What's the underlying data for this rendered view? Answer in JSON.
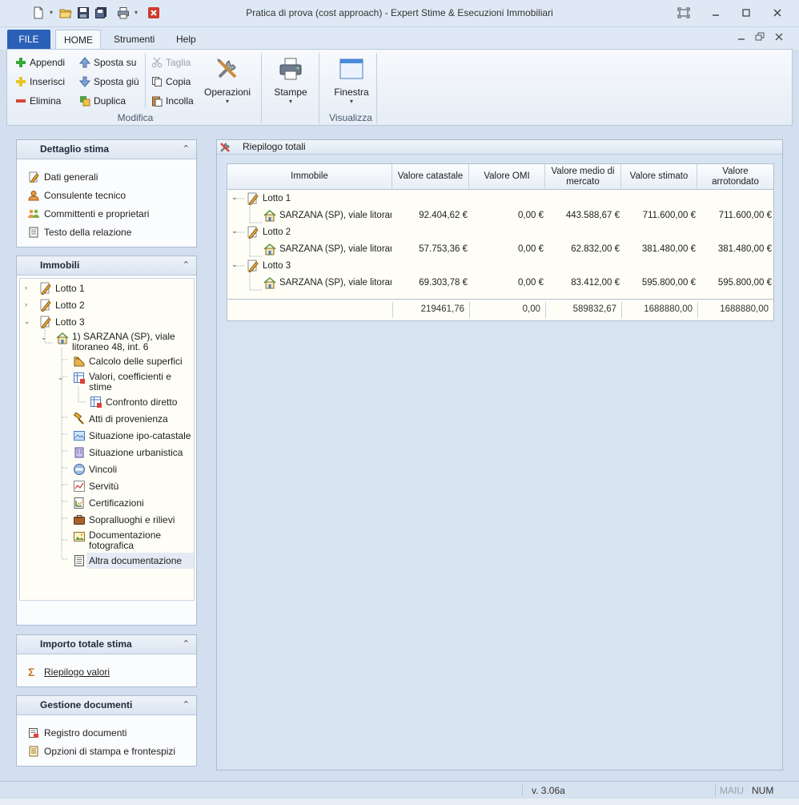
{
  "window": {
    "title": "Pratica di prova (cost approach) - Expert Stime & Esecuzioni Immobiliari"
  },
  "tabs": [
    {
      "label": "FILE"
    },
    {
      "label": "HOME"
    },
    {
      "label": "Strumenti"
    },
    {
      "label": "Help"
    }
  ],
  "ribbon": {
    "modifica": {
      "appendi": "Appendi",
      "inserisci": "Inserisci",
      "elimina": "Elimina",
      "sposta_su": "Sposta su",
      "sposta_giu": "Sposta giù",
      "duplica": "Duplica",
      "taglia": "Taglia",
      "copia": "Copia",
      "incolla": "Incolla",
      "operazioni": "Operazioni",
      "group_label": "Modifica"
    },
    "stampe": "Stampe",
    "finestra": "Finestra",
    "visualizza_label": "Visualizza"
  },
  "dettaglio": {
    "title": "Dettaglio stima",
    "items": [
      "Dati generali",
      "Consulente tecnico",
      "Committenti e proprietari",
      "Testo della relazione"
    ]
  },
  "immobili": {
    "title": "Immobili",
    "lotto1": "Lotto 1",
    "lotto2": "Lotto 2",
    "lotto3": "Lotto 3",
    "property_line1": "1) SARZANA (SP), viale",
    "property_line2": "litoraneo 48, int. 6",
    "calcolo": "Calcolo delle superfici",
    "valori_line1": "Valori, coefficienti e",
    "valori_line2": "stime",
    "confronto": "Confronto diretto",
    "atti": "Atti di provenienza",
    "ipo": "Situazione ipo-catastale",
    "urbanistica": "Situazione urbanistica",
    "vincoli": "Vincoli",
    "servitu": "Servitù",
    "certificazioni": "Certificazioni",
    "sopralluoghi": "Sopralluoghi e rilievi",
    "docfoto_line1": "Documentazione",
    "docfoto_line2": "fotografica",
    "altra": "Altra documentazione"
  },
  "importo": {
    "title": "Importo totale stima",
    "riepilogo": "Riepilogo valori"
  },
  "documenti": {
    "title": "Gestione documenti",
    "registro": "Registro documenti",
    "opzioni": "Opzioni di stampa e frontespizi"
  },
  "main": {
    "title": "Riepilogo totali",
    "columns": {
      "immobile": "Immobile",
      "catastale": "Valore catastale",
      "omi": "Valore OMI",
      "medio_line1": "Valore medio di",
      "medio_line2": "mercato",
      "stimato": "Valore stimato",
      "arr_line1": "Valore",
      "arr_line2": "arrotondato"
    },
    "rows": [
      {
        "lotto": "Lotto 1",
        "immobile": "SARZANA (SP), viale litorane",
        "catastale": "92.404,62 €",
        "omi": "0,00 €",
        "medio": "443.588,67 €",
        "stimato": "711.600,00 €",
        "arrotondato": "711.600,00 €"
      },
      {
        "lotto": "Lotto 2",
        "immobile": "SARZANA (SP), viale litorane",
        "catastale": "57.753,36 €",
        "omi": "0,00 €",
        "medio": "62.832,00 €",
        "stimato": "381.480,00 €",
        "arrotondato": "381.480,00 €"
      },
      {
        "lotto": "Lotto 3",
        "immobile": "SARZANA (SP), viale litorane",
        "catastale": "69.303,78 €",
        "omi": "0,00 €",
        "medio": "83.412,00 €",
        "stimato": "595.800,00 €",
        "arrotondato": "595.800,00 €"
      }
    ],
    "totals": {
      "catastale": "219461,76",
      "omi": "0,00",
      "medio": "589832,67",
      "stimato": "1688880,00",
      "arrotondato": "1688880,00"
    }
  },
  "status": {
    "version": "v. 3.06a",
    "maiu": "MAIU",
    "num": "NUM"
  },
  "colors": {
    "accent": "#2a60b8",
    "background": "#d3dfee",
    "tree_bg": "#fffef6"
  }
}
